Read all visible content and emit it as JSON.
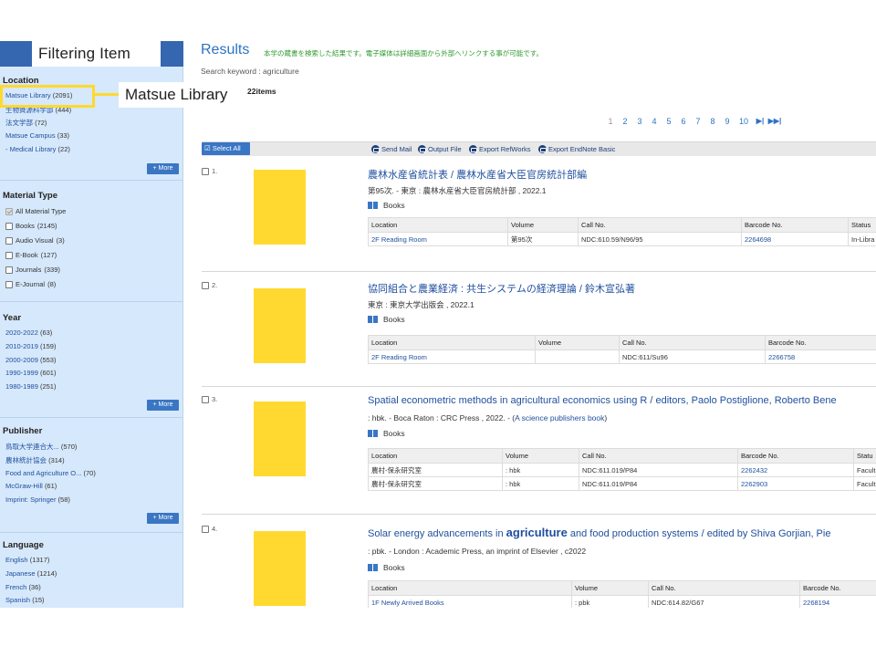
{
  "annotations": {
    "filtering_item": "Filtering Item",
    "location_callout": "Matsue Library"
  },
  "results_header": {
    "title": "Results",
    "note": "本学の蔵書を検索した結果です。電子媒体は詳細画面から外部へリンクする事が可能です。",
    "search_keyword": "Search keyword : agriculture",
    "items_count": "22items"
  },
  "sidebar": {
    "location": {
      "title": "Location",
      "items": [
        {
          "label": "Matsue Library",
          "count": "(2091)"
        },
        {
          "label": "生物資源科学部",
          "count": "(444)"
        },
        {
          "label": "法文学部",
          "count": "(72)"
        },
        {
          "label": "Matsue Campus",
          "count": "(33)"
        },
        {
          "label": "- Medical Library",
          "count": "(22)"
        }
      ],
      "more": "+ More"
    },
    "material_type": {
      "title": "Material Type",
      "items": [
        {
          "label": "All Material Type",
          "count": "",
          "checked": true
        },
        {
          "label": "Books",
          "count": "(2145)",
          "checked": false
        },
        {
          "label": "Audio Visual",
          "count": "(3)",
          "checked": false
        },
        {
          "label": "E-Book",
          "count": "(127)",
          "checked": false
        },
        {
          "label": "Journals",
          "count": "(339)",
          "checked": false
        },
        {
          "label": "E-Journal",
          "count": "(8)",
          "checked": false
        }
      ]
    },
    "year": {
      "title": "Year",
      "items": [
        {
          "label": "2020-2022",
          "count": "(63)"
        },
        {
          "label": "2010-2019",
          "count": "(159)"
        },
        {
          "label": "2000-2009",
          "count": "(553)"
        },
        {
          "label": "1990-1999",
          "count": "(601)"
        },
        {
          "label": "1980-1989",
          "count": "(251)"
        }
      ],
      "more": "+ More"
    },
    "publisher": {
      "title": "Publisher",
      "items": [
        {
          "label": "鳥取大学連合大...",
          "count": "(570)"
        },
        {
          "label": "農林統計協会",
          "count": "(314)"
        },
        {
          "label": "Food and Agriculture O...",
          "count": "(70)"
        },
        {
          "label": "McGraw-Hill",
          "count": "(61)"
        },
        {
          "label": "Imprint: Springer",
          "count": "(58)"
        }
      ],
      "more": "+ More"
    },
    "language": {
      "title": "Language",
      "items": [
        {
          "label": "English",
          "count": "(1317)"
        },
        {
          "label": "Japanese",
          "count": "(1214)"
        },
        {
          "label": "French",
          "count": "(36)"
        },
        {
          "label": "Spanish",
          "count": "(15)"
        }
      ]
    }
  },
  "pager": {
    "pages": [
      "1",
      "2",
      "3",
      "4",
      "5",
      "6",
      "7",
      "8",
      "9",
      "10"
    ],
    "next": "▶|",
    "last": "▶▶|"
  },
  "toolbar": {
    "select_all": "Select All",
    "send_mail": "Send Mail",
    "output_file": "Output File",
    "export_refworks": "Export RefWorks",
    "export_endnote": "Export EndNote Basic"
  },
  "results": [
    {
      "num": "1.",
      "title": "農林水産省統計表 / 農林水産省大臣官房統計部編",
      "pub": "第95次. - 東京 : 農林水産省大臣官房統計部 , 2022.1",
      "type": "Books",
      "columns": [
        "Location",
        "Volume",
        "Call No.",
        "Barcode No.",
        "Status"
      ],
      "rows": [
        [
          "2F Reading Room",
          "第95次",
          "NDC:610.59/N96/95",
          "2264698",
          "In-Libra"
        ]
      ]
    },
    {
      "num": "2.",
      "title": "協同組合と農業経済 : 共生システムの経済理論 / 鈴木宣弘著",
      "pub": "東京 : 東京大学出版会 , 2022.1",
      "type": "Books",
      "columns": [
        "Location",
        "Volume",
        "Call No.",
        "Barcode No."
      ],
      "rows": [
        [
          "2F Reading Room",
          "",
          "NDC:611/Su96",
          "2266758"
        ]
      ]
    },
    {
      "num": "3.",
      "title": "Spatial econometric methods in agricultural economics using R / editors, Paolo Postiglione, Roberto Bene",
      "pub_pre": ": hbk. - Boca Raton : CRC Press , 2022. - (",
      "pub_link": "A science publishers book",
      "pub_post": ")",
      "type": "Books",
      "columns": [
        "Location",
        "Volume",
        "Call No.",
        "Barcode No.",
        "Statu"
      ],
      "rows": [
        [
          "農村-保永研究室",
          ": hbk",
          "NDC:611.019/P84",
          "2262432",
          "Facult"
        ],
        [
          "農村-保永研究室",
          ": hbk",
          "NDC:611.019/P84",
          "2262903",
          "Facult"
        ]
      ]
    },
    {
      "num": "4.",
      "title_pre": "Solar energy advancements in ",
      "title_em": "agriculture",
      "title_post": " and food production systems / edited by Shiva Gorjian, Pie",
      "pub": ": pbk. - London : Academic Press, an imprint of Elsevier , c2022",
      "type": "Books",
      "columns": [
        "Location",
        "Volume",
        "Call No.",
        "Barcode No."
      ],
      "rows": [
        [
          "1F Newly Arrived Books",
          ": pbk",
          "NDC:614.82/G67",
          "2268194"
        ]
      ]
    }
  ]
}
